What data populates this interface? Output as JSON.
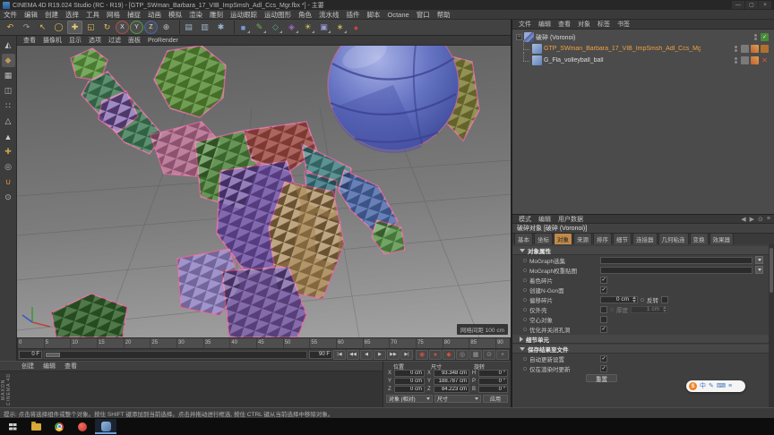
{
  "window": {
    "title": "CINEMA 4D R19.024 Studio (RC - R19) - [GTP_SWman_Barbara_17_VIB_ImpSmsh_Adl_Ccs_Mgr.fbx *] - 主要",
    "controls": [
      "—",
      "▢",
      "×"
    ]
  },
  "menu_bar": {
    "items": [
      "文件",
      "编辑",
      "创建",
      "选择",
      "工具",
      "网格",
      "捕捉",
      "动画",
      "模拟",
      "渲染",
      "雕刻",
      "运动跟踪",
      "运动图形",
      "角色",
      "流水线",
      "插件",
      "脚本",
      "Octane",
      "窗口",
      "帮助"
    ]
  },
  "toolbar": {
    "icons": [
      {
        "name": "undo-icon",
        "glyph": "↶",
        "color": "#e2b94e"
      },
      {
        "name": "redo-icon",
        "glyph": "↷",
        "color": "#9f9f9f"
      },
      {
        "name": "selection-tool-icon",
        "glyph": "↖",
        "color": "#e2b94e"
      },
      {
        "name": "live-selection-icon",
        "glyph": "◯",
        "color": "#e2b94e"
      },
      {
        "name": "move-tool-icon",
        "glyph": "✚",
        "color": "#e8d070",
        "_class": "active"
      },
      {
        "name": "scale-tool-icon",
        "glyph": "◱",
        "color": "#e2b94e"
      },
      {
        "name": "rotate-tool-icon",
        "glyph": "↻",
        "color": "#e2b94e"
      },
      {
        "name": "x-axis-button",
        "glyph": "X",
        "color": "#e0e0e0",
        "ring": "#b25048",
        "_class": "badge"
      },
      {
        "name": "y-axis-button",
        "glyph": "Y",
        "color": "#e0e0e0",
        "ring": "#55a048",
        "_class": "badge"
      },
      {
        "name": "z-axis-button",
        "glyph": "Z",
        "color": "#e0e0e0",
        "ring": "#4868b2",
        "_class": "badge"
      },
      {
        "name": "coord-system-icon",
        "glyph": "⊕",
        "color": "#b8b8b8"
      },
      {
        "_class": "sep"
      },
      {
        "name": "render-view-icon",
        "glyph": "▤",
        "color": "#9ab2cc"
      },
      {
        "name": "render-region-icon",
        "glyph": "▥",
        "color": "#9ab2cc"
      },
      {
        "name": "render-settings-icon",
        "glyph": "✱",
        "color": "#9ab2cc"
      },
      {
        "_class": "sep"
      },
      {
        "name": "add-cube-icon",
        "glyph": "■",
        "color": "#7a9ad2",
        "_class": "arrow"
      },
      {
        "name": "pen-spline-icon",
        "glyph": "✎",
        "color": "#74b257",
        "_class": "arrow"
      },
      {
        "name": "mograph-icon",
        "glyph": "◇",
        "color": "#54b2a0",
        "_class": "arrow"
      },
      {
        "name": "deformer-icon",
        "glyph": "◈",
        "color": "#a268c2",
        "_class": "arrow"
      },
      {
        "name": "environment-icon",
        "glyph": "☀",
        "color": "#d2c257",
        "_class": "arrow"
      },
      {
        "name": "camera-icon",
        "glyph": "▣",
        "color": "#9a9ad2",
        "_class": "arrow"
      },
      {
        "name": "light-icon",
        "glyph": "∗",
        "color": "#d2c257",
        "_class": "arrow"
      },
      {
        "name": "octane-icon",
        "glyph": "●",
        "color": "#c4483c"
      }
    ]
  },
  "left_toolbar": {
    "icons": [
      {
        "name": "make-editable-icon",
        "glyph": "◭",
        "color": "#b8c2cc"
      },
      {
        "name": "model-mode-icon",
        "glyph": "◆",
        "color": "#c29a5a",
        "_class": "active"
      },
      {
        "name": "texture-mode-icon",
        "glyph": "▦",
        "color": "#b8b8b8"
      },
      {
        "name": "workplane-icon",
        "glyph": "◫",
        "color": "#b8b8b8"
      },
      {
        "name": "points-mode-icon",
        "glyph": "∷",
        "color": "#cccccc"
      },
      {
        "name": "edges-mode-icon",
        "glyph": "△",
        "color": "#cccccc"
      },
      {
        "name": "polygons-mode-icon",
        "glyph": "▲",
        "color": "#cccccc"
      },
      {
        "name": "axis-mode-icon",
        "glyph": "✚",
        "color": "#c2a24e"
      },
      {
        "name": "solo-mode-icon",
        "glyph": "◎",
        "color": "#b8b8b8"
      },
      {
        "name": "snap-icon",
        "glyph": "∪",
        "color": "#e09a44"
      },
      {
        "name": "lock-workplane-icon",
        "glyph": "⊙",
        "color": "#b8b8b8"
      }
    ]
  },
  "viewport": {
    "menus": [
      "查看",
      "摄像机",
      "显示",
      "选项",
      "过滤",
      "面板",
      "ProRender"
    ],
    "grid_label": "网格间距 100 cm"
  },
  "timeline": {
    "ticks": [
      "0",
      "5",
      "10",
      "15",
      "20",
      "25",
      "30",
      "35",
      "40",
      "45",
      "50",
      "55",
      "60",
      "65",
      "70",
      "75",
      "80",
      "85",
      "90"
    ],
    "start_field": "0 F",
    "end_field": "90 F",
    "transport": [
      {
        "name": "goto-start-button",
        "glyph": "|◀"
      },
      {
        "name": "prev-key-button",
        "glyph": "◀◀"
      },
      {
        "name": "prev-frame-button",
        "glyph": "◀"
      },
      {
        "name": "play-button",
        "glyph": "▶"
      },
      {
        "name": "next-frame-button",
        "glyph": "▶▶"
      },
      {
        "name": "goto-end-button",
        "glyph": "▶|"
      }
    ],
    "keys": [
      {
        "name": "record-keyframe-button",
        "glyph": "◉",
        "color": "#cf5040"
      },
      {
        "name": "autokey-button",
        "glyph": "●",
        "color": "#cf5040"
      },
      {
        "name": "keyframe-selection-button",
        "glyph": "◆",
        "color": "#cf5040"
      },
      {
        "name": "position-key-toggle",
        "glyph": "◎",
        "color": "#9a9a9a"
      },
      {
        "name": "scale-key-toggle",
        "glyph": "▦",
        "color": "#9a9a9a"
      },
      {
        "name": "rotation-key-toggle",
        "glyph": "⊙",
        "color": "#9a9a9a"
      },
      {
        "name": "parameter-key-toggle",
        "glyph": "+",
        "color": "#9a9a9a"
      }
    ]
  },
  "materials": {
    "menus": [
      "创建",
      "编辑",
      "查看"
    ],
    "watermark": "MAXON CINEMA 4D"
  },
  "coordinates": {
    "headers": [
      "位置",
      "尺寸",
      "旋转"
    ],
    "axis_labels": [
      "X",
      "Y",
      "Z"
    ],
    "rot_labels": [
      "H",
      "P",
      "B"
    ],
    "pos_values": [
      "0 cm",
      "0 cm",
      "0 cm"
    ],
    "size_values": [
      "93.348 cm",
      "188.787 cm",
      "84.223 cm"
    ],
    "rot_values": [
      "0 °",
      "0 °",
      "0 °"
    ],
    "mode_select": "对象 (相对)",
    "size_select": "尺寸",
    "apply_label": "应用"
  },
  "object_manager": {
    "tabs": [
      "文件",
      "编辑",
      "查看",
      "对象",
      "标签",
      "书签"
    ],
    "expand_glyph": "−",
    "check_glyph": "✓",
    "x_glyph": "✕",
    "objects": [
      {
        "label": "破碎 (Voronoi)"
      },
      {
        "label": "GTP_SWman_Barbara_17_VIB_ImpSmsh_Adl_Ccs_Mgr"
      },
      {
        "label": "G_Fla_volleyball_ball"
      }
    ]
  },
  "attributes": {
    "menus": [
      "模式",
      "编辑",
      "用户数据"
    ],
    "nav_icons": [
      {
        "name": "back-icon",
        "glyph": "◀"
      },
      {
        "name": "forward-icon",
        "glyph": "▶"
      },
      {
        "name": "lock-icon",
        "glyph": "⊙"
      },
      {
        "name": "panel-menu-icon",
        "glyph": "≡"
      }
    ],
    "title": "破碎对象 [破碎 (Voronoi)]",
    "tabs": [
      {
        "label": "基本"
      },
      {
        "label": "坐标"
      },
      {
        "label": "对象",
        "_class": "active"
      },
      {
        "label": "来源"
      },
      {
        "label": "排序"
      },
      {
        "label": "细节"
      },
      {
        "label": "连接器"
      },
      {
        "label": "几何粘连"
      },
      {
        "label": "变换"
      },
      {
        "label": "效果器"
      }
    ],
    "section_object": "对象属性",
    "rows": {
      "mograph_selection": {
        "label": "MoGraph选集",
        "value": ""
      },
      "mograph_weightmap": {
        "label": "MoGraph权重贴图",
        "value": ""
      },
      "colorize": {
        "label": "着色碎片",
        "checked": "✓"
      },
      "ngons": {
        "label": "创建N-Gon面",
        "checked": "✓"
      },
      "offset": {
        "label": "偏移碎片",
        "value": "0 cm"
      },
      "invert": {
        "label": "反转",
        "checked": ""
      },
      "hull_only": {
        "label": "仅外壳",
        "checked": ""
      },
      "thickness": {
        "label": "厚度",
        "value": "1 cm"
      },
      "hollow": {
        "label": "空心对象",
        "checked": ""
      },
      "optimize": {
        "label": "优化并关闭孔洞",
        "checked": "✓"
      }
    },
    "section_detail": "细节单元",
    "section_cache": "保存结果至文件",
    "cache_rows": {
      "auto_update": {
        "label": "自动更新设置",
        "checked": "✓"
      },
      "render_update": {
        "label": "仅在渲染时更新",
        "checked": "✓"
      }
    },
    "reset_label": "重置"
  },
  "status_bar": {
    "text": "提示: 点击将选择组件或整个对象。按住 SHIFT 键添加到当前选择。点击并拖动进行框选, 按住 CTRL 键从当前选择中移除对象。"
  },
  "ime": {
    "logo": "S",
    "icons": [
      {
        "name": "ime-lang-icon",
        "glyph": "中"
      },
      {
        "name": "ime-pen-icon",
        "glyph": "✎"
      },
      {
        "name": "ime-keyboard-icon",
        "glyph": "⌨"
      },
      {
        "name": "ime-menu-icon",
        "glyph": "≡"
      }
    ]
  }
}
